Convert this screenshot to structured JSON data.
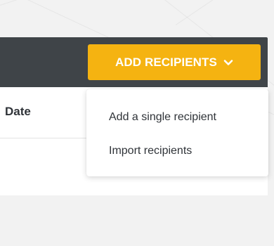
{
  "toolbar": {
    "add_recipients_label": "ADD RECIPIENTS",
    "add_recipients_icon": "chevron-down-icon",
    "accent_color": "#f5b311",
    "header_color": "#3f4448"
  },
  "table": {
    "columns": [
      "Date"
    ]
  },
  "dropdown": {
    "items": [
      {
        "label": "Add a single recipient"
      },
      {
        "label": "Import recipients"
      }
    ]
  }
}
